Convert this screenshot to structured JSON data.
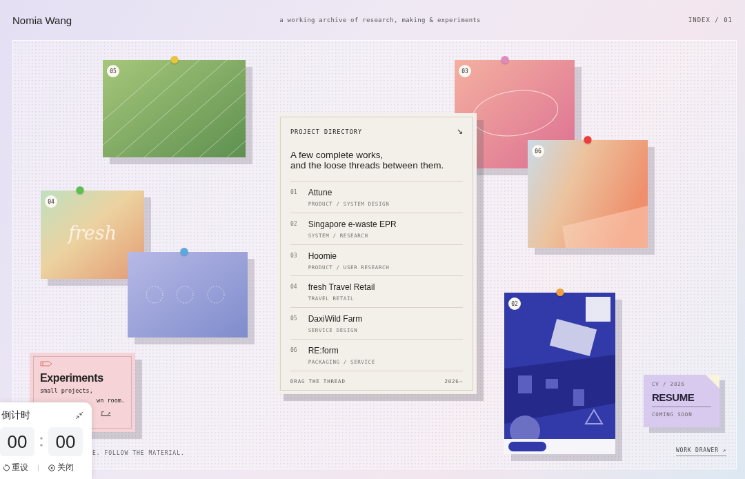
{
  "header": {
    "name": "Nomia Wang",
    "tagline": "a working archive of research, making & experiments",
    "index": "INDEX / 01"
  },
  "cards": [
    {
      "kind": "stripes",
      "badge": "05"
    },
    {
      "kind": "fresh",
      "badge": "04",
      "art_text": "fresh"
    },
    {
      "kind": "circles"
    },
    {
      "kind": "ellipse",
      "badge": "03"
    },
    {
      "kind": "gradient",
      "badge": "06"
    },
    {
      "kind": "poster",
      "badge": "02"
    }
  ],
  "directory": {
    "title": "PROJECT DIRECTORY",
    "arrow": "↘",
    "headline": "A few complete works,\nand the loose threads between them.",
    "projects": [
      {
        "index": "01",
        "name": "Attune",
        "tags": "PRODUCT / SYSTEM DESIGN"
      },
      {
        "index": "02",
        "name": "Singapore e-waste EPR",
        "tags": "SYSTEM / RESEARCH"
      },
      {
        "index": "03",
        "name": "Hoomie",
        "tags": "PRODUCT / USER RESEARCH"
      },
      {
        "index": "04",
        "name": "fresh Travel Retail",
        "tags": "TRAVEL RETAIL"
      },
      {
        "index": "05",
        "name": "DaxiWild Farm",
        "tags": "SERVICE DESIGN"
      },
      {
        "index": "06",
        "name": "RE:form",
        "tags": "PACKAGING / SERVICE"
      }
    ],
    "footer_left": "DRAG THE THREAD",
    "footer_right": "2026–"
  },
  "experiments": {
    "title": "Experiments",
    "lines": [
      "small projects,",
      "wn room."
    ],
    "link": "r ↗"
  },
  "resume": {
    "label": "CV / 2026",
    "title": "RESUME",
    "status": "COMING SOON"
  },
  "footer_note": "E. FOLLOW THE MATERIAL.",
  "work_drawer": "WORK DRAWER ↗",
  "timer": {
    "title": "倒计时",
    "minutes": "00",
    "seconds": "00",
    "reset": "重设",
    "close": "关闭"
  }
}
